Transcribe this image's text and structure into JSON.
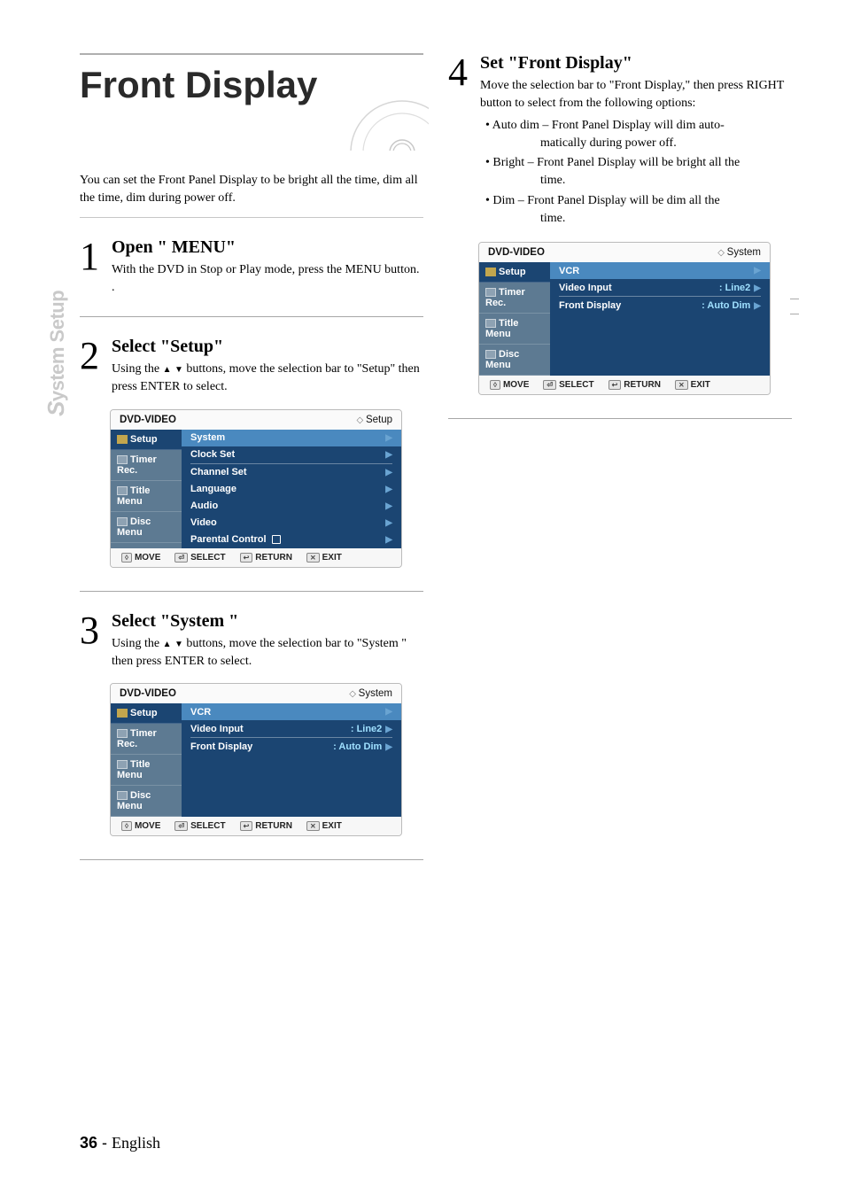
{
  "side_tab": {
    "first_letter": "S",
    "rest": "ystem Setup"
  },
  "title": "Front Display",
  "intro": "You can set the Front Panel Display to be bright all the time, dim all the time, dim during power off.",
  "steps": {
    "s1": {
      "num": "1",
      "title": "Open \" MENU\"",
      "text": "With the DVD in Stop or Play mode, press the MENU button. ."
    },
    "s2": {
      "num": "2",
      "title": "Select \"Setup\"",
      "text_a": "Using the ",
      "text_b": "  buttons, move the selection bar to \"Setup\" then press ENTER to select."
    },
    "s3": {
      "num": "3",
      "title": "Select \"System \"",
      "text_a": "Using the ",
      "text_b": " buttons, move the selection bar to \"System \" then press ENTER to select."
    },
    "s4": {
      "num": "4",
      "title": "Set \"Front Display\"",
      "text": "Move the selection bar to \"Front Display,\" then press RIGHT button to select from the following options:",
      "b1a": "• Auto dim – Front Panel Display will dim auto-",
      "b1b": "matically during power off.",
      "b2a": "• Bright – Front Panel Display will be bright all the",
      "b2b": "time.",
      "b3a": "• Dim – Front Panel Display will be dim all the",
      "b3b": "time."
    }
  },
  "osd": {
    "header_left": "DVD-VIDEO",
    "tabs": {
      "setup": "Setup",
      "timer": "Timer Rec.",
      "title": "Title Menu",
      "disc": "Disc Menu"
    },
    "footer": {
      "move": "MOVE",
      "select": "SELECT",
      "return": "RETURN",
      "exit": "EXIT"
    },
    "setup": {
      "crumb": "Setup",
      "items": [
        "System",
        "Clock Set",
        "Channel Set",
        "Language",
        "Audio",
        "Video",
        "Parental Control"
      ]
    },
    "system": {
      "crumb": "System",
      "rows": {
        "vcr": "VCR",
        "video_input": "Video Input",
        "video_input_val": ": Line2",
        "front_display": "Front Display",
        "front_display_val": ": Auto Dim"
      }
    }
  },
  "footer": {
    "page": "36",
    "sep": " - ",
    "lang": "English"
  }
}
